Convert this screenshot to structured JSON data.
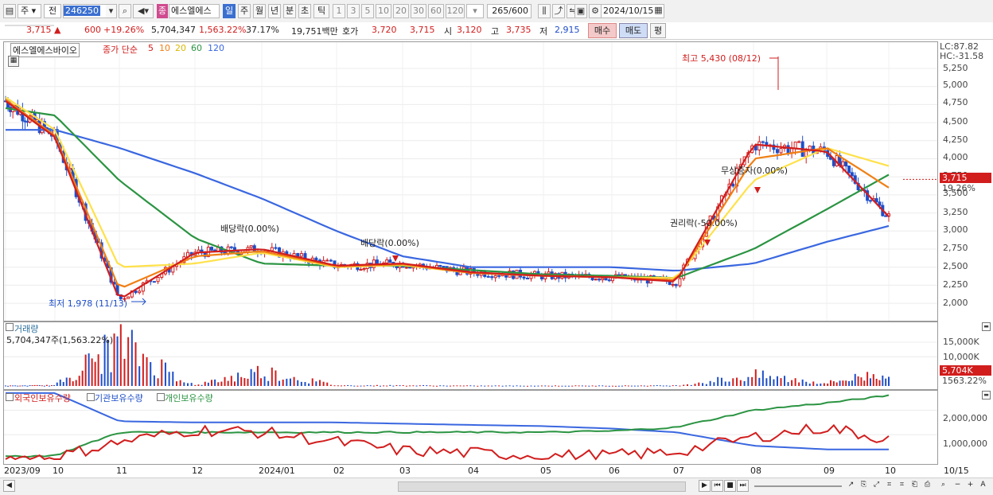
{
  "toolbar": {
    "market_type": "주",
    "prev_label": "전",
    "stock_code": "246250",
    "stock_name": "에스엘에스",
    "periods": [
      "일",
      "주",
      "월",
      "년",
      "분",
      "초",
      "틱"
    ],
    "intervals": [
      "1",
      "3",
      "5",
      "10",
      "20",
      "30",
      "60",
      "120"
    ],
    "count": "265",
    "count_total": "/600",
    "date": "2024/10/15",
    "color_flag": "종"
  },
  "quote": {
    "price": "3,715",
    "change": "600",
    "change_rate": "+19.26%",
    "volume": "5,704,347",
    "volume_rate": "1,563.22%",
    "turnover_rate": "37.17%",
    "amount": "19,751백만",
    "bid_label": "호가",
    "bid1": "3,720",
    "bid2": "3,715",
    "open_label": "시",
    "open": "3,120",
    "high_label": "고",
    "high": "3,735",
    "low_label": "저",
    "low": "2,915",
    "buy_button": "매수",
    "sell_button": "매도",
    "eval_button": "평"
  },
  "price_pane": {
    "stock_label": "에스엘에스바이오",
    "ma_title": "종가 단순",
    "ma_periods": [
      "5",
      "10",
      "20",
      "60",
      "120"
    ],
    "lc_label": "LC:87.82",
    "hc_label": "HC:-31.58",
    "current_price_tag": "3,715",
    "current_change_tag": "19.26%",
    "annotations": {
      "high": "최고 5,430 (08/12)",
      "low": "최저 1,978 (11/13)",
      "dividend1": "배당락(0.00%)",
      "dividend2": "배당락(0.00%)",
      "rights": "권리락(-50.00%)",
      "bonus": "무상증자(0.00%)"
    },
    "y_ticks": [
      "5,250",
      "5,000",
      "4,750",
      "4,500",
      "4,250",
      "4,000",
      "3,750",
      "3,500",
      "3,250",
      "3,000",
      "2,750",
      "2,500",
      "2,250",
      "2,000"
    ]
  },
  "volume_pane": {
    "title": "거래량",
    "value_label": "5,704,347주(1,563.22%)",
    "y_ticks": [
      "15,000K",
      "10,000K"
    ],
    "current_tag": "5,704K",
    "current_rate_tag": "1563.22%"
  },
  "holding_pane": {
    "legend": [
      "외국인보유수량",
      "기관보유수량",
      "개인보유수량"
    ],
    "y_ticks": [
      "2,000,000",
      "1,000,000"
    ]
  },
  "x_axis": {
    "labels": [
      "2023/09",
      "10",
      "11",
      "12",
      "2024/01",
      "02",
      "03",
      "04",
      "05",
      "06",
      "07",
      "08",
      "09",
      "10"
    ],
    "end_label": "10/15"
  },
  "colors": {
    "ma5": "#d21d1d",
    "ma10": "#f07f14",
    "ma20": "#ffe14a",
    "ma60": "#2b9442",
    "ma120": "#3a67e0",
    "up": "#d21d1d",
    "down": "#1e4ec8",
    "foreign": "#d21d1d",
    "institution": "#3a67e0",
    "individual": "#2b9442"
  },
  "chart_data": {
    "type": "line",
    "x": [
      "2023/09",
      "10",
      "11",
      "12",
      "2024/01",
      "02",
      "03",
      "04",
      "05",
      "06",
      "07",
      "08",
      "09",
      "10"
    ],
    "series": [
      {
        "name": "5",
        "values": [
          4800,
          4300,
          2050,
          2700,
          2750,
          2520,
          2550,
          2430,
          2380,
          2360,
          2300,
          4200,
          4100,
          3200
        ]
      },
      {
        "name": "10",
        "values": [
          4820,
          4320,
          2200,
          2650,
          2720,
          2510,
          2540,
          2420,
          2380,
          2360,
          2320,
          4000,
          4150,
          3600
        ]
      },
      {
        "name": "20",
        "values": [
          4850,
          4400,
          2500,
          2550,
          2700,
          2500,
          2530,
          2420,
          2380,
          2360,
          2350,
          3700,
          4150,
          3900
        ]
      },
      {
        "name": "60",
        "values": [
          4700,
          4600,
          3700,
          2900,
          2550,
          2520,
          2520,
          2460,
          2400,
          2380,
          2350,
          2750,
          3300,
          3780
        ]
      },
      {
        "name": "120",
        "values": [
          4400,
          4400,
          4150,
          3800,
          3450,
          3000,
          2650,
          2500,
          2500,
          2500,
          2450,
          2550,
          2850,
          3070
        ]
      }
    ],
    "volume_k": [
      120,
      300,
      17000,
      250,
      6000,
      250,
      250,
      150,
      150,
      150,
      220,
      4200,
      1200,
      5704
    ],
    "ylim": [
      1900,
      5400
    ]
  }
}
